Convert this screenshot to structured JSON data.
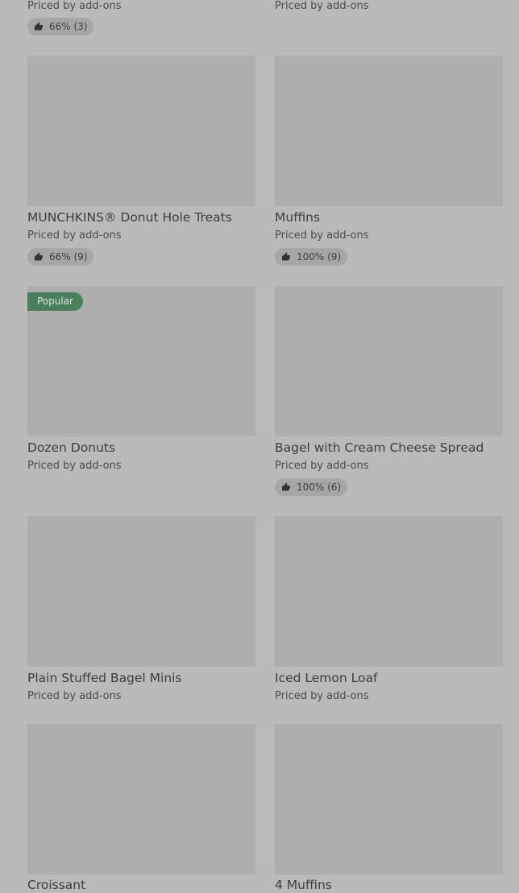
{
  "menu": {
    "top_left": {
      "price": "Priced by add-ons",
      "rating": "66% (3)"
    },
    "top_right": {
      "price": "Priced by add-ons"
    },
    "items": [
      {
        "name": "MUNCHKINS® Donut Hole Treats",
        "price": "Priced by add-ons",
        "rating": "66% (9)"
      },
      {
        "name": "Muffins",
        "price": "Priced by add-ons",
        "rating": "100% (9)"
      },
      {
        "name": "Dozen Donuts",
        "price": "Priced by add-ons",
        "badge": "Popular"
      },
      {
        "name": "Bagel with Cream Cheese Spread",
        "price": "Priced by add-ons",
        "rating": "100% (6)"
      },
      {
        "name": "Plain Stuffed Bagel Minis",
        "price": "Priced by add-ons"
      },
      {
        "name": "Iced Lemon Loaf",
        "price": "Priced by add-ons"
      },
      {
        "name": "Croissant"
      },
      {
        "name": "4 Muffins"
      }
    ]
  },
  "icons": {
    "rating": "thumbs-up-icon"
  },
  "colors": {
    "overlay_background": "#bababa",
    "image_placeholder": "#aeaeae",
    "badge": "#4a7f5e"
  }
}
